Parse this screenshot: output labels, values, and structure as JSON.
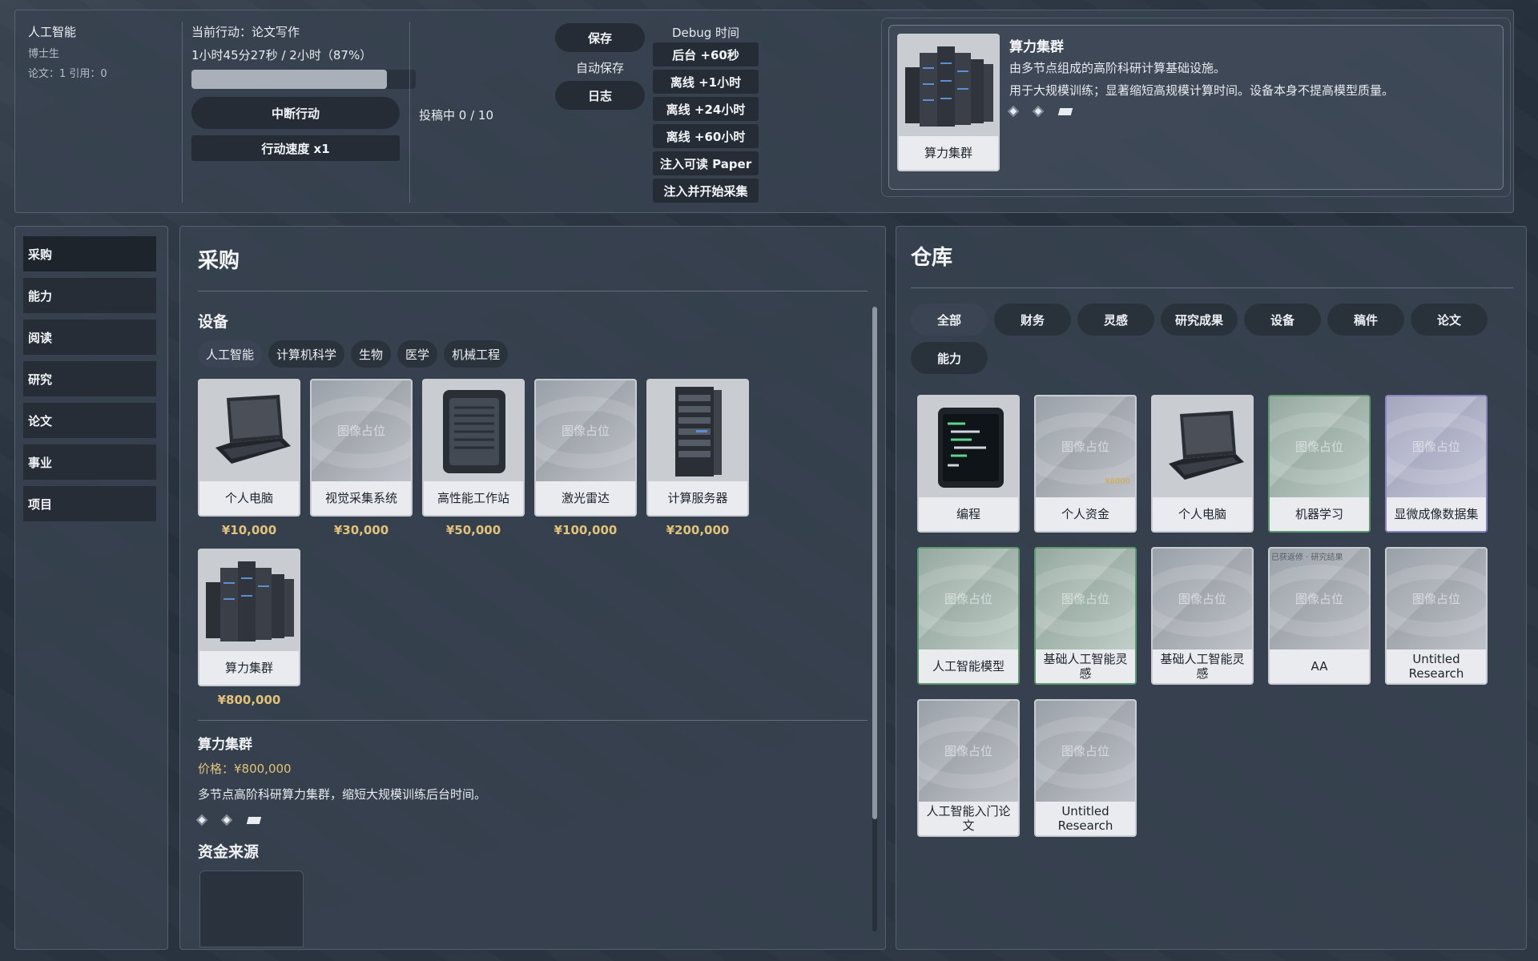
{
  "profile": {
    "name": "人工智能",
    "degree": "博士生",
    "stats": "论文：1 引用：0"
  },
  "action": {
    "current": "当前行动：论文写作",
    "progress_text": "1小时45分27秒 / 2小时（87%）",
    "progress_fraction": 0.87,
    "interrupt_label": "中断行动",
    "speed_label": "行动速度 x1"
  },
  "submission": "投稿中 0 / 10",
  "save": {
    "save_label": "保存",
    "autosave_label": "自动保存",
    "log_label": "日志"
  },
  "debug": {
    "title": "Debug 时间",
    "buttons": [
      "后台 +60秒",
      "离线 +1小时",
      "离线 +24小时",
      "离线 +60小时",
      "注入可读 Paper",
      "注入并开始采集"
    ]
  },
  "detail": {
    "thumb_label": "算力集群",
    "title": "算力集群",
    "line1": "由多节点组成的高阶科研计算基础设施。",
    "line2": "用于大规模训练；显著缩短高规模计算时间。设备本身不提高模型质量。"
  },
  "sidebar": {
    "items": [
      "采购",
      "能力",
      "阅读",
      "研究",
      "论文",
      "事业",
      "项目"
    ]
  },
  "purchase": {
    "title": "采购",
    "section": "设备",
    "chips": [
      "人工智能",
      "计算机科学",
      "生物",
      "医学",
      "机械工程"
    ],
    "placeholder": "图像占位",
    "items": [
      {
        "label": "个人电脑",
        "price": "¥10,000",
        "icon": "laptop-icon"
      },
      {
        "label": "视觉采集系统",
        "price": "¥30,000",
        "icon": "placeholder-image"
      },
      {
        "label": "高性能工作站",
        "price": "¥50,000",
        "icon": "workstation-icon"
      },
      {
        "label": "激光雷达",
        "price": "¥100,000",
        "icon": "placeholder-image"
      },
      {
        "label": "计算服务器",
        "price": "¥200,000",
        "icon": "server-icon"
      },
      {
        "label": "算力集群",
        "price": "¥800,000",
        "icon": "cluster-icon"
      }
    ],
    "selected": {
      "title": "算力集群",
      "price": "价格：¥800,000",
      "desc": "多节点高阶科研算力集群，缩短大规模训练后台时间。"
    },
    "funds_title": "资金来源"
  },
  "warehouse": {
    "title": "仓库",
    "tabs": [
      "全部",
      "财务",
      "灵感",
      "研究成果",
      "设备",
      "稿件",
      "论文",
      "能力"
    ],
    "placeholder": "图像占位",
    "money_tag": "¥8000",
    "corner_tag": "已获返修 · 研究结果",
    "items": [
      {
        "label": "编程"
      },
      {
        "label": "个人资金"
      },
      {
        "label": "个人电脑"
      },
      {
        "label": "机器学习"
      },
      {
        "label": "显微成像数据集"
      },
      {
        "label": "人工智能模型"
      },
      {
        "label": "基础人工智能灵感"
      },
      {
        "label": "基础人工智能灵感"
      },
      {
        "label": "AA"
      },
      {
        "label": "Untitled Research"
      },
      {
        "label": "人工智能入门论文"
      },
      {
        "label": "Untitled Research"
      }
    ]
  }
}
